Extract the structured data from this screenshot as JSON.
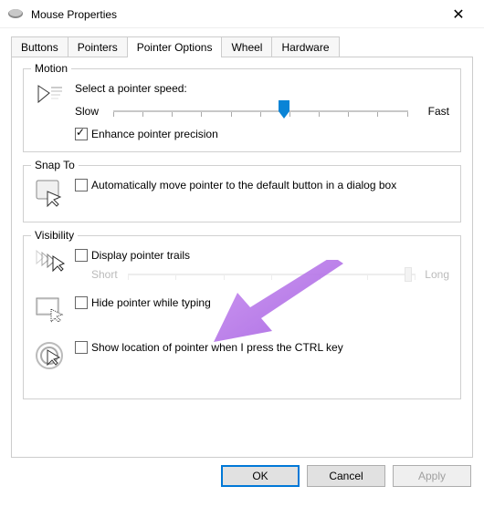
{
  "window": {
    "title": "Mouse Properties",
    "close_glyph": "✕"
  },
  "tabs": {
    "buttons": "Buttons",
    "pointers": "Pointers",
    "pointer_options": "Pointer Options",
    "wheel": "Wheel",
    "hardware": "Hardware"
  },
  "motion": {
    "group_label": "Motion",
    "speed_label": "Select a pointer speed:",
    "slow": "Slow",
    "fast": "Fast",
    "enhance": "Enhance pointer precision",
    "enhance_checked": true
  },
  "snap_to": {
    "group_label": "Snap To",
    "auto_move": "Automatically move pointer to the default button in a dialog box",
    "checked": false
  },
  "visibility": {
    "group_label": "Visibility",
    "trails": "Display pointer trails",
    "trails_short": "Short",
    "trails_long": "Long",
    "hide_typing": "Hide pointer while typing",
    "show_ctrl": "Show location of pointer when I press the CTRL key"
  },
  "buttons": {
    "ok": "OK",
    "cancel": "Cancel",
    "apply": "Apply"
  }
}
